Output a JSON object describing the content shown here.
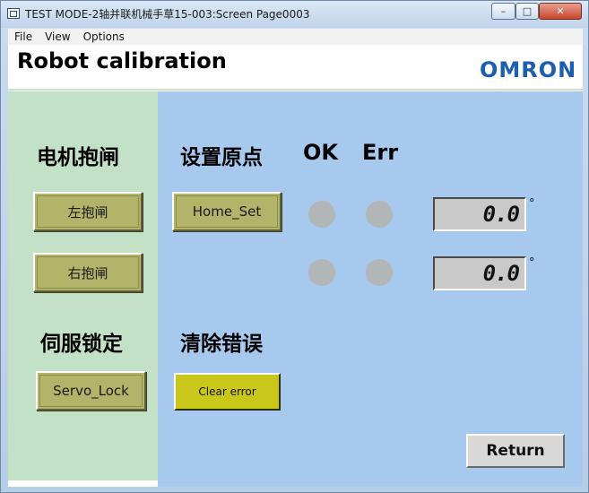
{
  "window": {
    "title": "TEST MODE-2轴并联机械手草15-003:Screen Page0003",
    "minimize": "–",
    "maximize": "□",
    "close": "✕"
  },
  "menu": {
    "items": [
      "File",
      "View",
      "Options"
    ]
  },
  "header": {
    "title": "Robot calibration",
    "brand": "OMRON"
  },
  "left_panel": {
    "motor_brake_label": "电机抱闸",
    "left_brake_button": "左抱闸",
    "right_brake_button": "右抱闸",
    "servo_lock_label": "伺服锁定",
    "servo_lock_button": "Servo_Lock"
  },
  "main_panel": {
    "set_origin_label": "设置原点",
    "ok_label": "OK",
    "err_label": "Err",
    "home_set_button": "Home_Set",
    "clear_error_label": "清除错误",
    "clear_error_button": "Clear error",
    "return_button": "Return",
    "readouts": [
      {
        "value": "0.0",
        "unit": "°"
      },
      {
        "value": "0.0",
        "unit": "°"
      }
    ],
    "lamp_color_off": "#b3b6b9"
  },
  "colors": {
    "left_panel_bg": "#c3e1c6",
    "main_panel_bg": "#a7c9ee",
    "olive_button": "#b2b46a",
    "yellow_button": "#c9c81a",
    "brand": "#1b5fae"
  }
}
